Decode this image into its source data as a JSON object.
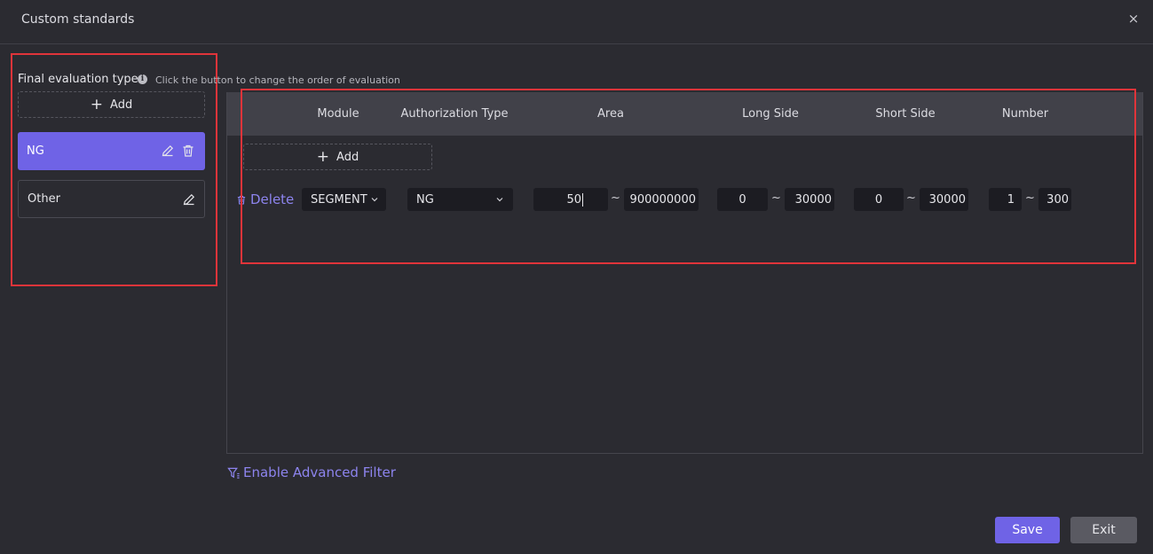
{
  "dialog": {
    "title": "Custom standards",
    "close_label": "×"
  },
  "left": {
    "label": "Final evaluation type",
    "hint": "Click the button to change the order of evaluation",
    "add_label": "Add",
    "items": [
      {
        "label": "NG",
        "selected": true
      },
      {
        "label": "Other",
        "selected": false
      }
    ]
  },
  "table": {
    "headers": [
      "Module",
      "Authorization Type",
      "Area",
      "Long Side",
      "Short Side",
      "Number"
    ],
    "add_label": "Add",
    "rows": [
      {
        "delete_label": "Delete",
        "module": "SEGMENT",
        "authorization_type": "NG",
        "area_min": "50",
        "area_max": "900000000",
        "long_min": "0",
        "long_max": "30000",
        "short_min": "0",
        "short_max": "30000",
        "number_min": "1",
        "number_max": "300",
        "separator": "~"
      }
    ]
  },
  "advanced_filter_label": "Enable Advanced Filter",
  "footer": {
    "save_label": "Save",
    "exit_label": "Exit"
  },
  "colors": {
    "accent": "#6f63e6",
    "link": "#8d84ee",
    "highlight_frame": "#e0343a",
    "background": "#2b2b31"
  },
  "icons": [
    "info-icon",
    "plus-icon",
    "edit-icon",
    "trash-icon",
    "chevron-down-icon",
    "filter-icon",
    "close-icon"
  ]
}
